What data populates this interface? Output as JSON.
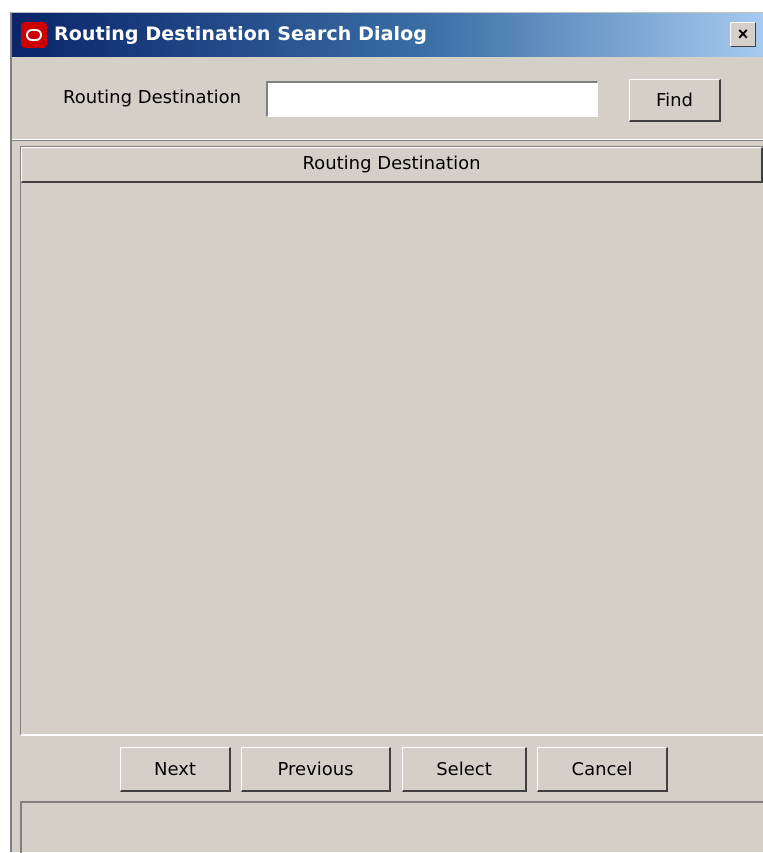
{
  "window": {
    "title": "Routing Destination Search Dialog",
    "close_label": "×",
    "icon": "oracle-logo-icon"
  },
  "search": {
    "label": "Routing Destination",
    "value": "",
    "placeholder": "",
    "find_label": "Find"
  },
  "table": {
    "columns": [
      "Routing Destination"
    ],
    "rows": []
  },
  "buttons": {
    "next": "Next",
    "previous": "Previous",
    "select": "Select",
    "cancel": "Cancel"
  },
  "status_bar": {
    "text": ""
  },
  "colors": {
    "dialog_background": "#d4d0c8",
    "titlebar_start": "#0a246a",
    "titlebar_end": "#a6caf0",
    "logo_red": "#cc0000"
  }
}
